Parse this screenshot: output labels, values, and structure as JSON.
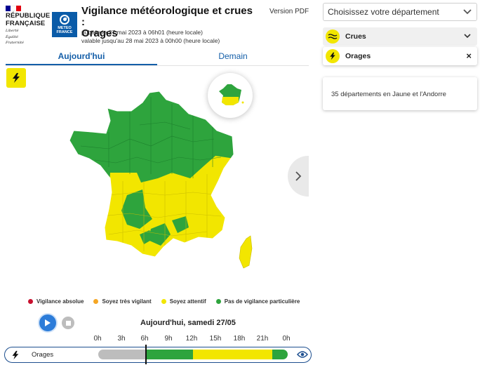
{
  "header": {
    "republique_line1": "RÉPUBLIQUE",
    "republique_line2": "FRANÇAISE",
    "motto_1": "Liberté",
    "motto_2": "Égalité",
    "motto_3": "Fraternité",
    "meteo_line1": "METEO",
    "meteo_line2": "FRANCE",
    "title_line1": "Vigilance météorologique et crues :",
    "title_line2": "Orages",
    "published": "publiée le 27 mai 2023 à 06h01 (heure locale)",
    "valid_until": "valable jusqu'au 28 mai 2023 à 00h00 (heure locale)",
    "version_pdf": "Version PDF",
    "flag_colors": [
      "#000091",
      "#ffffff",
      "#e1000f"
    ]
  },
  "tabs": [
    {
      "label": "Aujourd'hui",
      "active": true
    },
    {
      "label": "Demain",
      "active": false
    }
  ],
  "legend": [
    {
      "label": "Vigilance absolue",
      "color": "#c8102e"
    },
    {
      "label": "Soyez très vigilant",
      "color": "#f5a623"
    },
    {
      "label": "Soyez attentif",
      "color": "#f2e600"
    },
    {
      "label": "Pas de vigilance particulière",
      "color": "#2ea43d"
    }
  ],
  "colors": {
    "green": "#2ea43d",
    "yellow": "#f2e600",
    "grey": "#bdbdbd",
    "accent_blue": "#145ea8"
  },
  "player": {
    "day_label": "Aujourd'hui, samedi 27/05",
    "hours": [
      "0h",
      "3h",
      "6h",
      "9h",
      "12h",
      "15h",
      "18h",
      "21h",
      "0h"
    ],
    "current_hour": 6,
    "timeline_label": "Orages",
    "segments": [
      {
        "from_hour": 0,
        "to_hour": 6,
        "level": "past"
      },
      {
        "from_hour": 6,
        "to_hour": 12,
        "level": "green"
      },
      {
        "from_hour": 12,
        "to_hour": 22,
        "level": "yellow"
      },
      {
        "from_hour": 22,
        "to_hour": 24,
        "level": "green"
      }
    ]
  },
  "panel": {
    "select_placeholder": "Choisissez votre département",
    "crues_label": "Crues",
    "orages_label": "Orages",
    "summary": "35 départements en Jaune et l'Andorre"
  },
  "icons": {
    "bolt": "lightning-icon",
    "waves": "waves-icon",
    "eye": "eye-icon",
    "chevron_down": "chevron-down-icon",
    "chevron_right": "chevron-right-icon",
    "close": "close-icon",
    "play": "play-icon",
    "stop": "stop-icon"
  }
}
